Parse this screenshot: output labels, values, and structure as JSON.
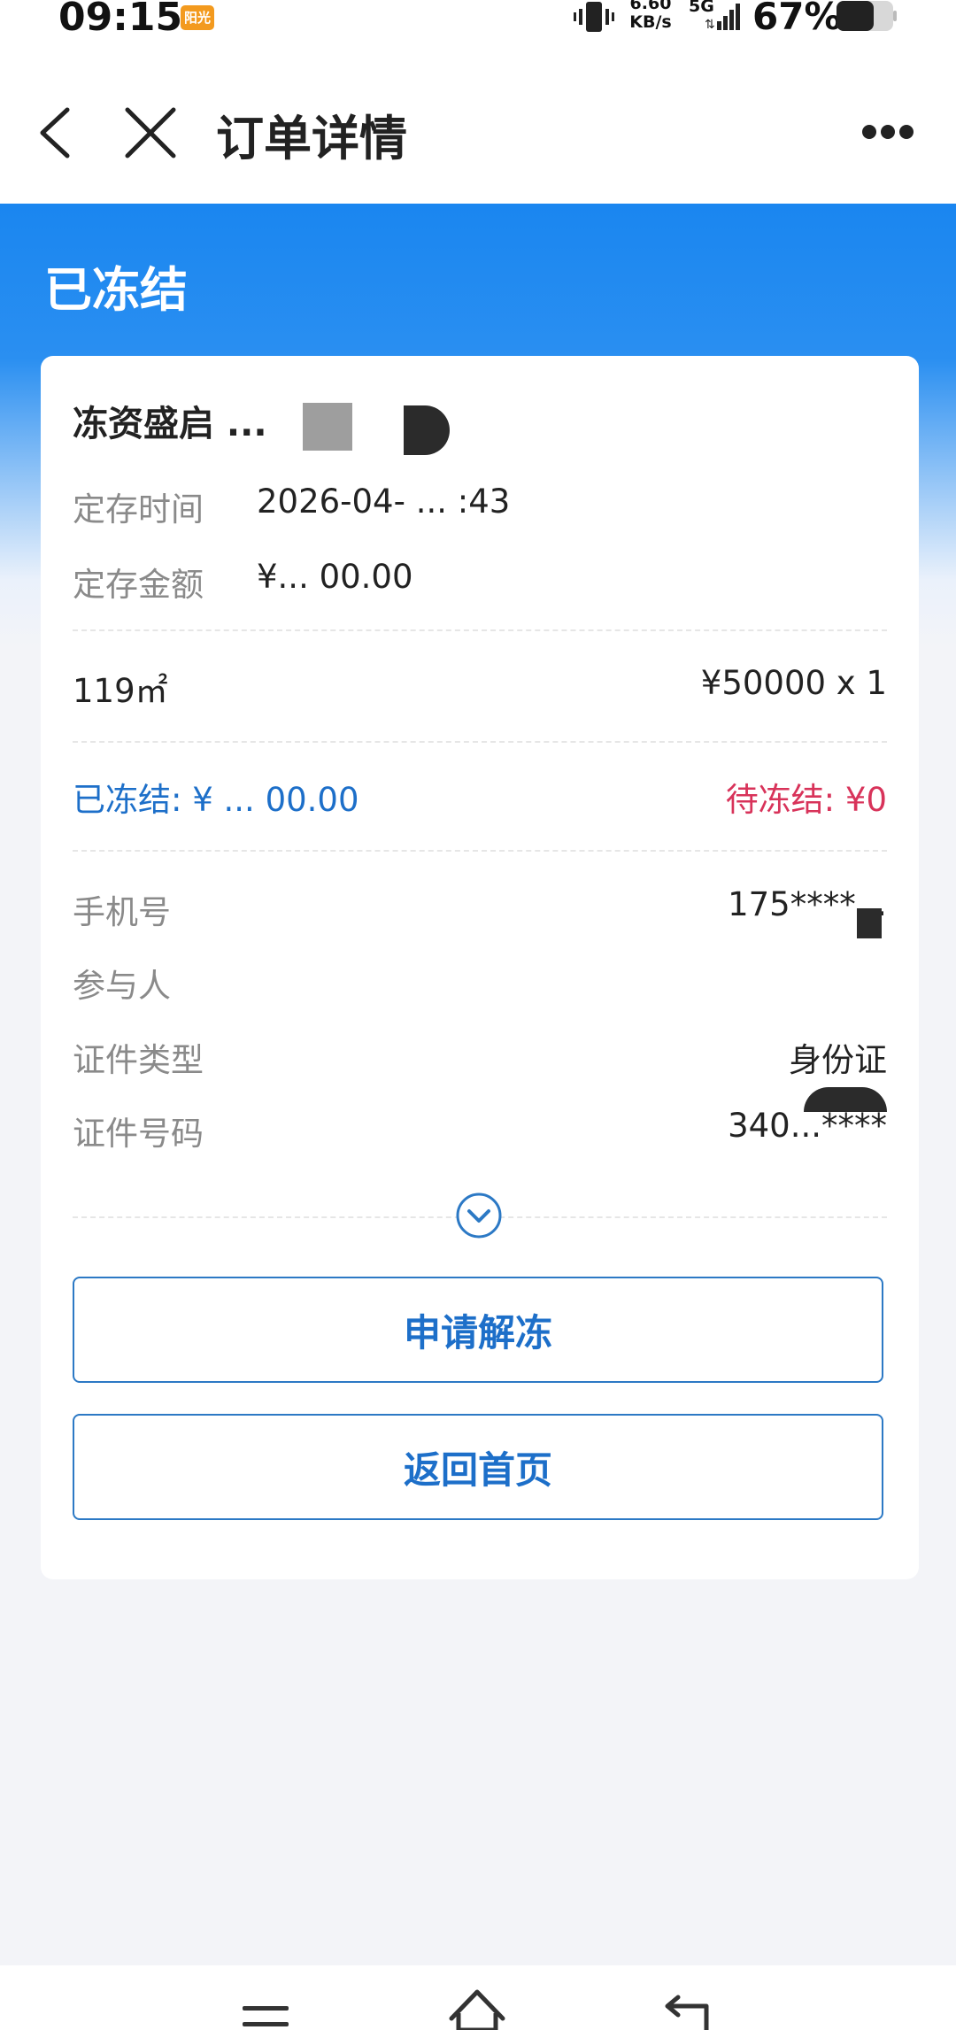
{
  "status_bar": {
    "time": "09:15",
    "carrier_badge": "阳光",
    "net_speed": "6.60\nKB/s",
    "net_type": "5G",
    "battery": "67%"
  },
  "nav": {
    "title": "订单详情"
  },
  "header": {
    "status": "已冻结"
  },
  "card": {
    "product_name": "冻资盛启 ...",
    "deposit_time_label": "定存时间",
    "deposit_time_value": "2026-04- ... :43",
    "deposit_amount_label": "定存金额",
    "deposit_amount_value": "¥... 00.00",
    "item_spec": "119㎡",
    "item_price": "¥50000 x 1",
    "frozen_amount": "已冻结: ¥ ... 00.00",
    "pending_amount": "待冻结: ¥0",
    "phone_label": "手机号",
    "phone_value": "175****...",
    "participant_label": "参与人",
    "participant_value": "",
    "id_type_label": "证件类型",
    "id_type_value": "身份证",
    "id_number_label": "证件号码",
    "id_number_value": "340...****"
  },
  "buttons": {
    "unfreeze": "申请解冻",
    "back_home": "返回首页"
  },
  "colors": {
    "accent_blue": "#1d6fc9",
    "header_blue": "#1a86f0",
    "pending_red": "#d8335a"
  }
}
